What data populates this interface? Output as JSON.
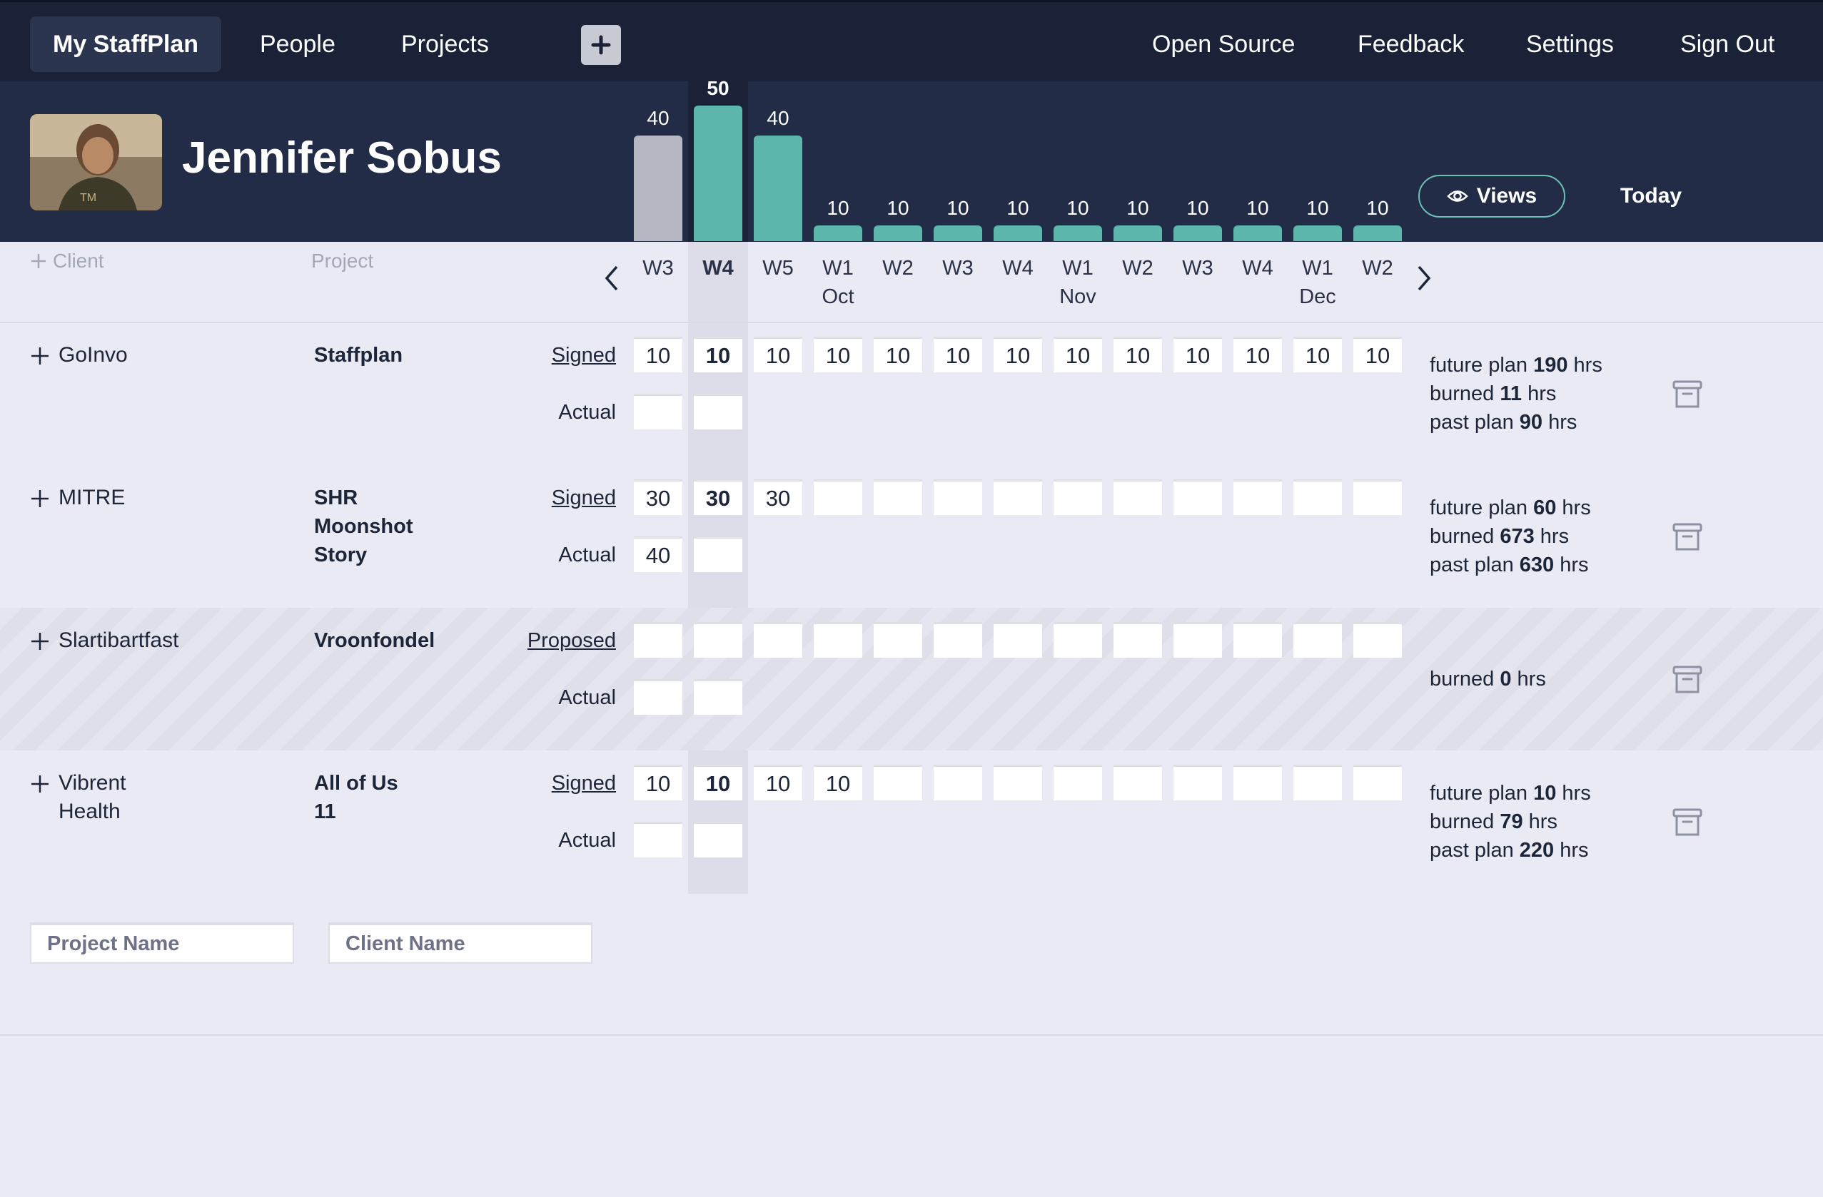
{
  "nav": {
    "items": [
      {
        "label": "My StaffPlan",
        "active": true
      },
      {
        "label": "People"
      },
      {
        "label": "Projects"
      }
    ],
    "right_items": [
      {
        "label": "Open Source"
      },
      {
        "label": "Feedback"
      },
      {
        "label": "Settings"
      },
      {
        "label": "Sign Out"
      }
    ],
    "add_icon": "plus-icon"
  },
  "header": {
    "person_name": "Jennifer Sobus",
    "views_label": "Views",
    "today_label": "Today"
  },
  "workload_chart": {
    "weeks": [
      "W3",
      "W4",
      "W5",
      "W1",
      "W2",
      "W3",
      "W4",
      "W1",
      "W2",
      "W3",
      "W4",
      "W1",
      "W2"
    ],
    "month_labels": [
      "",
      "",
      "",
      "Oct",
      "",
      "",
      "",
      "Nov",
      "",
      "",
      "",
      "Dec",
      ""
    ],
    "hours": [
      40,
      50,
      40,
      10,
      10,
      10,
      10,
      10,
      10,
      10,
      10,
      10,
      10
    ],
    "current_index": 1,
    "past_color": "#b5b7c2",
    "future_color": "#5db6ac"
  },
  "columns": {
    "client_label": "Client",
    "project_label": "Project"
  },
  "assignments": [
    {
      "client": [
        "GoInvo"
      ],
      "project": [
        "Staffplan"
      ],
      "status": "Signed",
      "actual_label": "Actual",
      "planned": [
        "10",
        "10",
        "10",
        "10",
        "10",
        "10",
        "10",
        "10",
        "10",
        "10",
        "10",
        "10",
        "10"
      ],
      "actual": [
        "",
        ""
      ],
      "summary": [
        {
          "pre": "future plan ",
          "val": "190",
          "post": " hrs"
        },
        {
          "pre": "burned ",
          "val": "11",
          "post": " hrs"
        },
        {
          "pre": "past plan ",
          "val": "90",
          "post": " hrs"
        }
      ]
    },
    {
      "client": [
        "MITRE"
      ],
      "project": [
        "SHR",
        "Moonshot",
        "Story"
      ],
      "status": "Signed",
      "actual_label": "Actual",
      "planned": [
        "30",
        "30",
        "30",
        "",
        "",
        "",
        "",
        "",
        "",
        "",
        "",
        "",
        ""
      ],
      "actual": [
        "40",
        ""
      ],
      "summary": [
        {
          "pre": "future plan ",
          "val": "60",
          "post": " hrs"
        },
        {
          "pre": "burned ",
          "val": "673",
          "post": " hrs"
        },
        {
          "pre": "past plan ",
          "val": "630",
          "post": " hrs"
        }
      ]
    },
    {
      "client": [
        "Slartibartfast"
      ],
      "project": [
        "Vroonfondel"
      ],
      "status": "Proposed",
      "actual_label": "Actual",
      "hatched": true,
      "planned": [
        "",
        "",
        "",
        "",
        "",
        "",
        "",
        "",
        "",
        "",
        "",
        "",
        ""
      ],
      "actual": [
        "",
        ""
      ],
      "summary": [
        {
          "pre": "burned ",
          "val": "0",
          "post": " hrs"
        }
      ]
    },
    {
      "client": [
        "Vibrent",
        "Health"
      ],
      "project": [
        "All of Us",
        "11"
      ],
      "status": "Signed",
      "actual_label": "Actual",
      "planned": [
        "10",
        "10",
        "10",
        "10",
        "",
        "",
        "",
        "",
        "",
        "",
        "",
        "",
        ""
      ],
      "actual": [
        "",
        ""
      ],
      "summary": [
        {
          "pre": "future plan ",
          "val": "10",
          "post": " hrs"
        },
        {
          "pre": "burned ",
          "val": "79",
          "post": " hrs"
        },
        {
          "pre": "past plan ",
          "val": "220",
          "post": " hrs"
        }
      ]
    }
  ],
  "new_assignment": {
    "project_placeholder": "Project Name",
    "client_placeholder": "Client Name"
  }
}
